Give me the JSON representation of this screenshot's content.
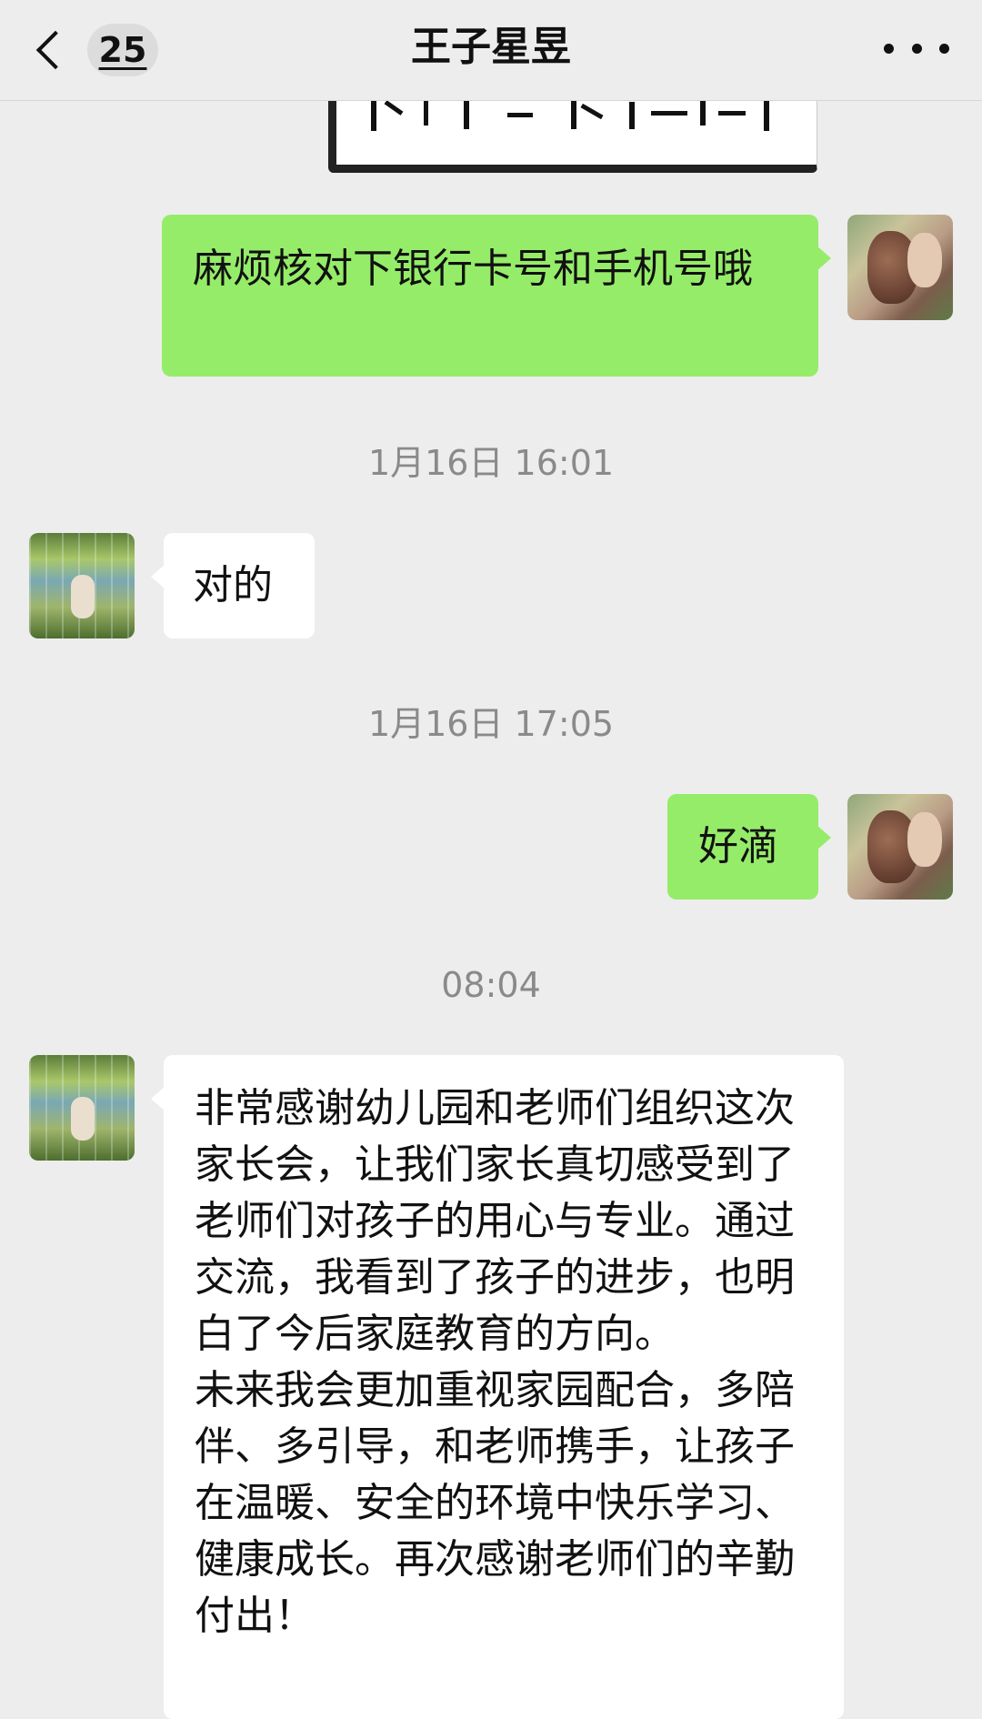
{
  "nav": {
    "back_count": "25",
    "title": "王子星昱",
    "more_icon": "more-dots-icon"
  },
  "messages": [
    {
      "sender": "me",
      "type": "text",
      "text": "麻烦核对下银行卡号和手机号哦"
    },
    {
      "type": "timestamp",
      "text": "1月16日 16:01"
    },
    {
      "sender": "them",
      "type": "text",
      "text": "对的"
    },
    {
      "type": "timestamp",
      "text": "1月16日 17:05"
    },
    {
      "sender": "me",
      "type": "text",
      "text": "好滴"
    },
    {
      "type": "timestamp",
      "text": "08:04"
    },
    {
      "sender": "them",
      "type": "text",
      "text": "非常感谢幼儿园和老师们组织这次家长会，让我们家长真切感受到了老师们对孩子的用心与专业。通过交流，我看到了孩子的进步，也明白了今后家庭教育的方向。\n未来我会更加重视家园配合，多陪伴、多引导，和老师携手，让孩子在温暖、安全的环境中快乐学习、健康成长。再次感谢老师们的辛勤付出！"
    }
  ],
  "colors": {
    "background": "#ededed",
    "my_bubble": "#95ec69",
    "their_bubble": "#ffffff",
    "timestamp_text": "#8a8a8a"
  }
}
